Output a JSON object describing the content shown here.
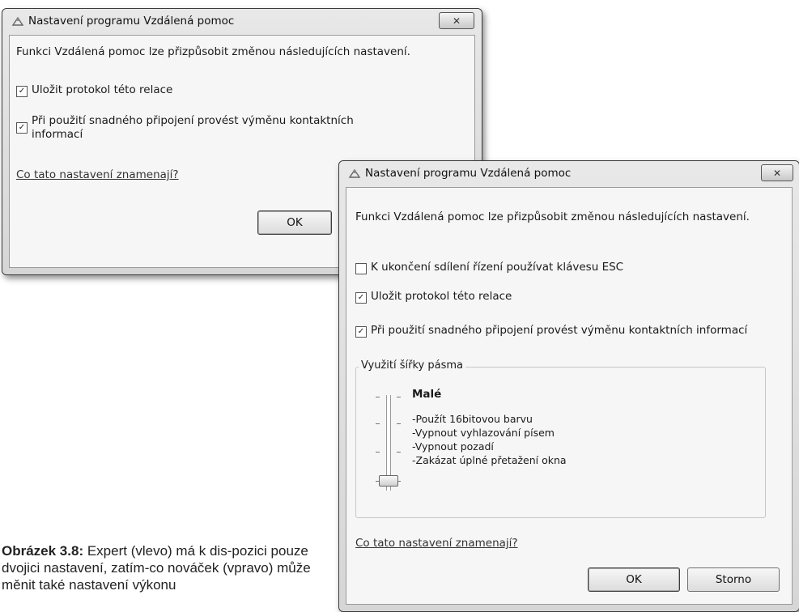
{
  "dialog_left": {
    "title": "Nastavení programu Vzdálená pomoc",
    "close_symbol": "✕",
    "intro": "Funkci Vzdálená pomoc lze přizpůsobit změnou následujících nastavení.",
    "checkboxes": [
      {
        "label": "Uložit protokol této relace",
        "checked": true
      },
      {
        "label_line1": "Při použití snadného připojení provést výměnu kontaktních",
        "label_line2": "informací",
        "checked": true
      }
    ],
    "help_link": "Co tato nastavení znamenají?",
    "ok_label": "OK"
  },
  "dialog_right": {
    "title": "Nastavení programu Vzdálená pomoc",
    "close_symbol": "✕",
    "intro": "Funkci Vzdálená pomoc lze přizpůsobit změnou následujících nastavení.",
    "checkboxes": [
      {
        "label": "K ukončení sdílení řízení používat klávesu ESC",
        "checked": false
      },
      {
        "label": "Uložit protokol této relace",
        "checked": true
      },
      {
        "label": "Při použití snadného připojení provést výměnu kontaktních informací",
        "checked": true
      }
    ],
    "bandwidth": {
      "legend": "Využití šířky pásma",
      "level_title": "Malé",
      "details": [
        "-Použít 16bitovou barvu",
        "-Vypnout vyhlazování písem",
        "-Vypnout pozadí",
        "-Zakázat úplné přetažení okna"
      ],
      "slider_position": "lowest"
    },
    "help_link": "Co tato nastavení znamenají?",
    "ok_label": "OK",
    "cancel_label": "Storno"
  },
  "caption": {
    "prefix": "Obrázek 3.8:",
    "text": " Expert (vlevo) má k dis-pozici pouze dvojici nastavení, zatím-co nováček (vpravo) může měnit také nastavení výkonu"
  },
  "icons": {
    "title_icon": "remote-assistance-icon",
    "check": "✓"
  }
}
